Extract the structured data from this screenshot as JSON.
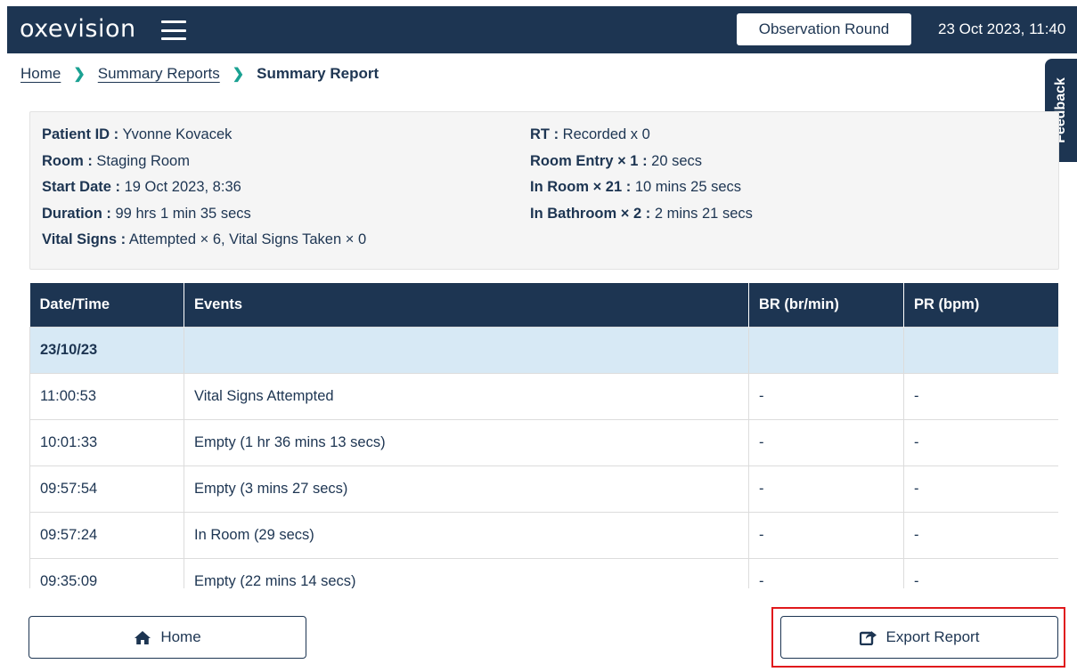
{
  "header": {
    "brand": "oxevision",
    "observation_button": "Observation Round",
    "datetime": "23 Oct 2023, 11:40"
  },
  "breadcrumb": {
    "home": "Home",
    "summary_reports": "Summary Reports",
    "current": "Summary Report"
  },
  "feedback_label": "Feedback",
  "info": {
    "patient_id": {
      "label": "Patient ID :",
      "value": " Yvonne Kovacek"
    },
    "room": {
      "label": "Room :",
      "value": " Staging Room"
    },
    "start_date": {
      "label": "Start Date :",
      "value": " 19 Oct 2023, 8:36"
    },
    "duration": {
      "label": "Duration :",
      "value": " 99 hrs 1 min 35 secs"
    },
    "vital_signs": {
      "label": "Vital Signs :",
      "value": " Attempted × 6,  Vital Signs Taken × 0"
    },
    "rt": {
      "label": "RT :",
      "value": " Recorded x 0"
    },
    "room_entry": {
      "label": "Room Entry × 1 :",
      "value": " 20 secs"
    },
    "in_room": {
      "label": "In Room × 21 :",
      "value": " 10 mins 25 secs"
    },
    "in_bathroom": {
      "label": "In Bathroom × 2 :",
      "value": " 2 mins 21 secs"
    }
  },
  "table": {
    "headers": [
      "Date/Time",
      "Events",
      "BR (br/min)",
      "PR (bpm)"
    ],
    "date_group": "23/10/23",
    "rows": [
      {
        "time": "11:00:53",
        "event": "Vital Signs Attempted",
        "br": "-",
        "pr": "-"
      },
      {
        "time": "10:01:33",
        "event": "Empty (1 hr 36 mins 13 secs)",
        "br": "-",
        "pr": "-"
      },
      {
        "time": "09:57:54",
        "event": "Empty (3 mins 27 secs)",
        "br": "-",
        "pr": "-"
      },
      {
        "time": "09:57:24",
        "event": "In Room (29 secs)",
        "br": "-",
        "pr": "-"
      },
      {
        "time": "09:35:09",
        "event": "Empty (22 mins 14 secs)",
        "br": "-",
        "pr": "-"
      }
    ]
  },
  "buttons": {
    "home": "Home",
    "export": "Export Report"
  },
  "colors": {
    "navy": "#1d3552",
    "teal": "#1aa192",
    "date_row": "#d7e9f5",
    "highlight": "#e0191c"
  }
}
